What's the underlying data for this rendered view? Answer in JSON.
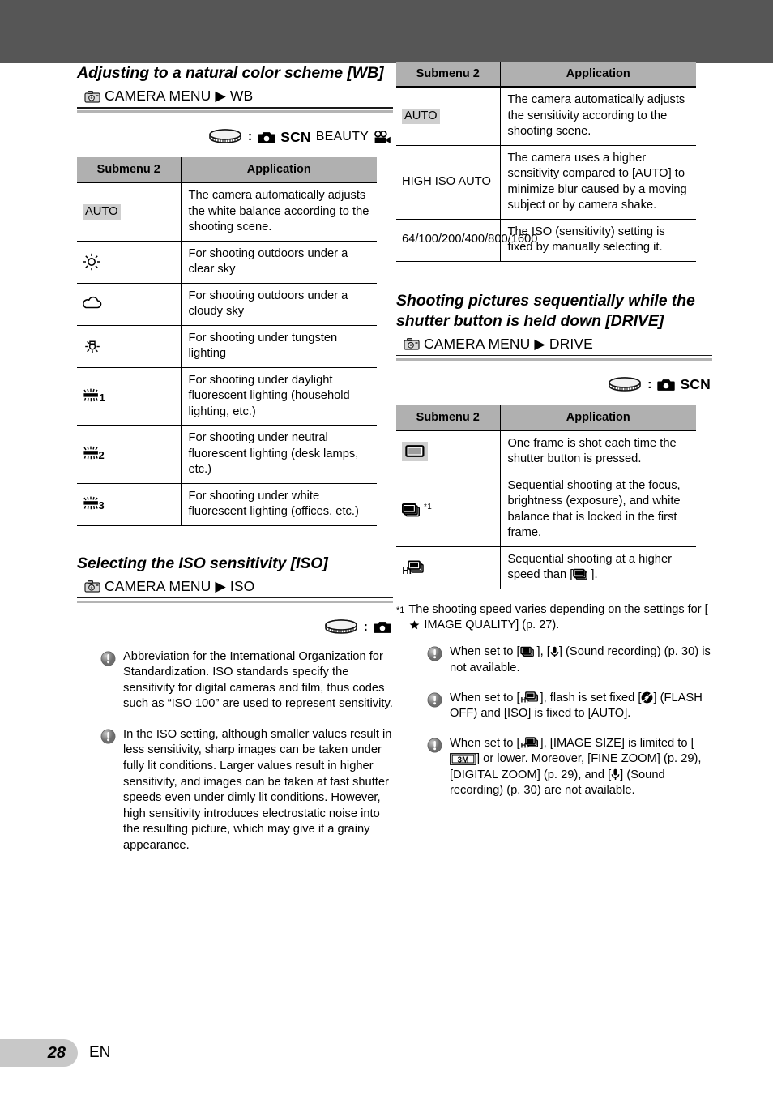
{
  "page": {
    "number": "28",
    "language": "EN"
  },
  "colors": {
    "header_band": "#565656",
    "table_header": "#b0b0b0",
    "highlight": "#cfcfcf",
    "page_tab": "#c8c8c8"
  },
  "left_column": {
    "wb": {
      "heading": "Adjusting to a natural color scheme [WB]",
      "menu_path": "CAMERA MENU ▶ WB",
      "menu_icon": "camera-menu-icon",
      "mode_icon": "mode-dial-icon",
      "modes": [
        "camera-mode-icon",
        "SCN",
        "BEAUTY",
        "movie-mode-icon"
      ],
      "table": {
        "headers": [
          "Submenu 2",
          "Application"
        ],
        "rows": [
          {
            "submenu": "AUTO",
            "submenu_icon": null,
            "highlighted": true,
            "application": "The camera automatically adjusts the white balance according to the shooting scene."
          },
          {
            "submenu": "",
            "submenu_icon": "sun-clear-sky-icon",
            "highlighted": false,
            "application": "For shooting outdoors under a clear sky"
          },
          {
            "submenu": "",
            "submenu_icon": "cloud-cloudy-sky-icon",
            "highlighted": false,
            "application": "For shooting outdoors under a cloudy sky"
          },
          {
            "submenu": "",
            "submenu_icon": "tungsten-lamp-icon",
            "highlighted": false,
            "application": "For shooting under tungsten lighting"
          },
          {
            "submenu": "",
            "submenu_icon": "fluorescent-1-icon",
            "highlighted": false,
            "application": "For shooting under daylight fluorescent lighting (household lighting, etc.)"
          },
          {
            "submenu": "",
            "submenu_icon": "fluorescent-2-icon",
            "highlighted": false,
            "application": "For shooting under neutral fluorescent lighting (desk lamps, etc.)"
          },
          {
            "submenu": "",
            "submenu_icon": "fluorescent-3-icon",
            "highlighted": false,
            "application": "For shooting under white fluorescent lighting (offices, etc.)"
          }
        ]
      }
    },
    "iso": {
      "heading": "Selecting the ISO sensitivity [ISO]",
      "menu_path": "CAMERA MENU ▶ ISO",
      "menu_icon": "camera-menu-icon",
      "mode_icon": "mode-dial-icon",
      "modes": [
        "camera-mode-icon"
      ],
      "notes": [
        "Abbreviation for the International Organization for Standardization. ISO standards specify the sensitivity for digital cameras and film, thus codes such as “ISO 100” are used to represent sensitivity.",
        "In the ISO setting, although smaller values result in less sensitivity, sharp images can be taken under fully lit conditions. Larger values result in higher sensitivity, and images can be taken at fast shutter speeds even under dimly lit conditions. However, high sensitivity introduces electrostatic noise into the resulting picture, which may give it a grainy appearance."
      ]
    }
  },
  "right_column": {
    "iso_table": {
      "headers": [
        "Submenu 2",
        "Application"
      ],
      "rows": [
        {
          "submenu": "AUTO",
          "highlighted": true,
          "application": "The camera automatically adjusts the sensitivity according to the shooting scene."
        },
        {
          "submenu": "HIGH ISO AUTO",
          "highlighted": false,
          "application": "The camera uses a higher sensitivity compared to [AUTO] to minimize blur caused by a moving subject or by camera shake."
        },
        {
          "submenu": "64/100/200/400/800/1600",
          "highlighted": false,
          "application": "The ISO (sensitivity) setting is fixed by manually selecting it."
        }
      ]
    },
    "drive": {
      "heading": "Shooting pictures sequentially while the shutter button is held down [DRIVE]",
      "menu_path": "CAMERA MENU ▶ DRIVE",
      "menu_icon": "camera-menu-icon",
      "mode_icon": "mode-dial-icon",
      "modes": [
        "camera-mode-icon",
        "SCN"
      ],
      "table": {
        "headers": [
          "Submenu 2",
          "Application"
        ],
        "rows": [
          {
            "submenu_icon": "single-frame-icon",
            "highlighted": true,
            "ref": "",
            "application": "One frame is shot each time the shutter button is pressed."
          },
          {
            "submenu_icon": "sequential-frames-icon",
            "highlighted": false,
            "ref": "*1",
            "application": "Sequential shooting at the focus, brightness (exposure), and white balance that is locked in the first frame."
          },
          {
            "submenu_icon": "hi-sequential-frames-icon",
            "highlighted": false,
            "ref": "",
            "application_pre": "Sequential shooting at a higher speed than [",
            "application_post": "]."
          }
        ]
      },
      "footnote": {
        "marker": "*1",
        "pre": "The shooting speed varies depending on the settings for [",
        "icon": "image-quality-icon",
        "post": " IMAGE QUALITY] (p. 27)."
      },
      "notes": [
        {
          "pre": "When set to [",
          "icon1": "sequential-frames-icon",
          "mid": "], [",
          "icon2": "microphone-icon",
          "post": "] (Sound recording) (p. 30) is not available."
        },
        {
          "pre": "When set to [",
          "icon1": "hi-sequential-frames-icon",
          "mid": "], flash is set fixed [",
          "icon2": "flash-off-icon",
          "post": "] (FLASH OFF) and [ISO] is fixed to [AUTO]."
        },
        {
          "pre": "When set to [",
          "icon1": "hi-sequential-frames-icon",
          "mid": "], [IMAGE SIZE] is limited to [",
          "icon2": "image-size-3m-icon",
          "post": "] or lower. Moreover, [FINE ZOOM] (p. 29), [DIGITAL ZOOM] (p. 29), and [",
          "icon3": "microphone-icon",
          "post2": "] (Sound recording) (p. 30) are not available."
        }
      ]
    }
  }
}
